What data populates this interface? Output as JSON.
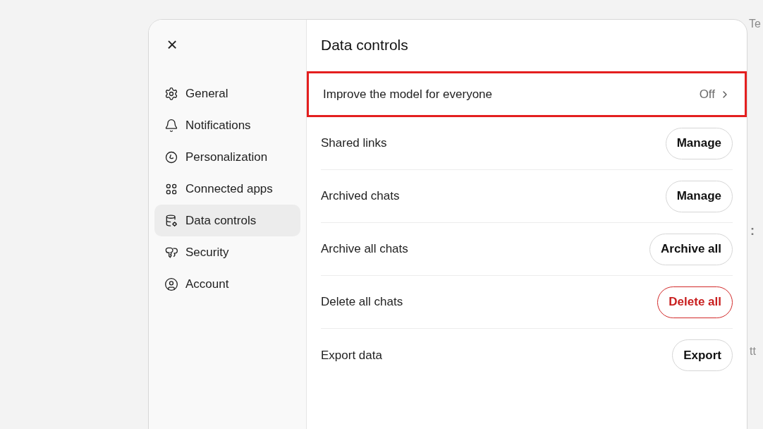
{
  "background_fragments": [
    "Te",
    ":",
    "tt"
  ],
  "dialog": {
    "close": "×",
    "sidebar": {
      "items": [
        {
          "kind": "general",
          "label": "General",
          "selected": false
        },
        {
          "kind": "notifications",
          "label": "Notifications",
          "selected": false
        },
        {
          "kind": "personalization",
          "label": "Personalization",
          "selected": false
        },
        {
          "kind": "apps",
          "label": "Connected apps",
          "selected": false
        },
        {
          "kind": "data",
          "label": "Data controls",
          "selected": true
        },
        {
          "kind": "security",
          "label": "Security",
          "selected": false
        },
        {
          "kind": "account",
          "label": "Account",
          "selected": false
        }
      ]
    },
    "title": "Data controls",
    "rows": [
      {
        "kind": "link",
        "label": "Improve the model for everyone",
        "value": "Off",
        "highlighted": true
      },
      {
        "kind": "button",
        "label": "Shared links",
        "button": "Manage",
        "danger": false
      },
      {
        "kind": "button",
        "label": "Archived chats",
        "button": "Manage",
        "danger": false
      },
      {
        "kind": "button",
        "label": "Archive all chats",
        "button": "Archive all",
        "danger": false
      },
      {
        "kind": "button",
        "label": "Delete all chats",
        "button": "Delete all",
        "danger": true
      },
      {
        "kind": "button",
        "label": "Export data",
        "button": "Export",
        "danger": false
      }
    ]
  }
}
